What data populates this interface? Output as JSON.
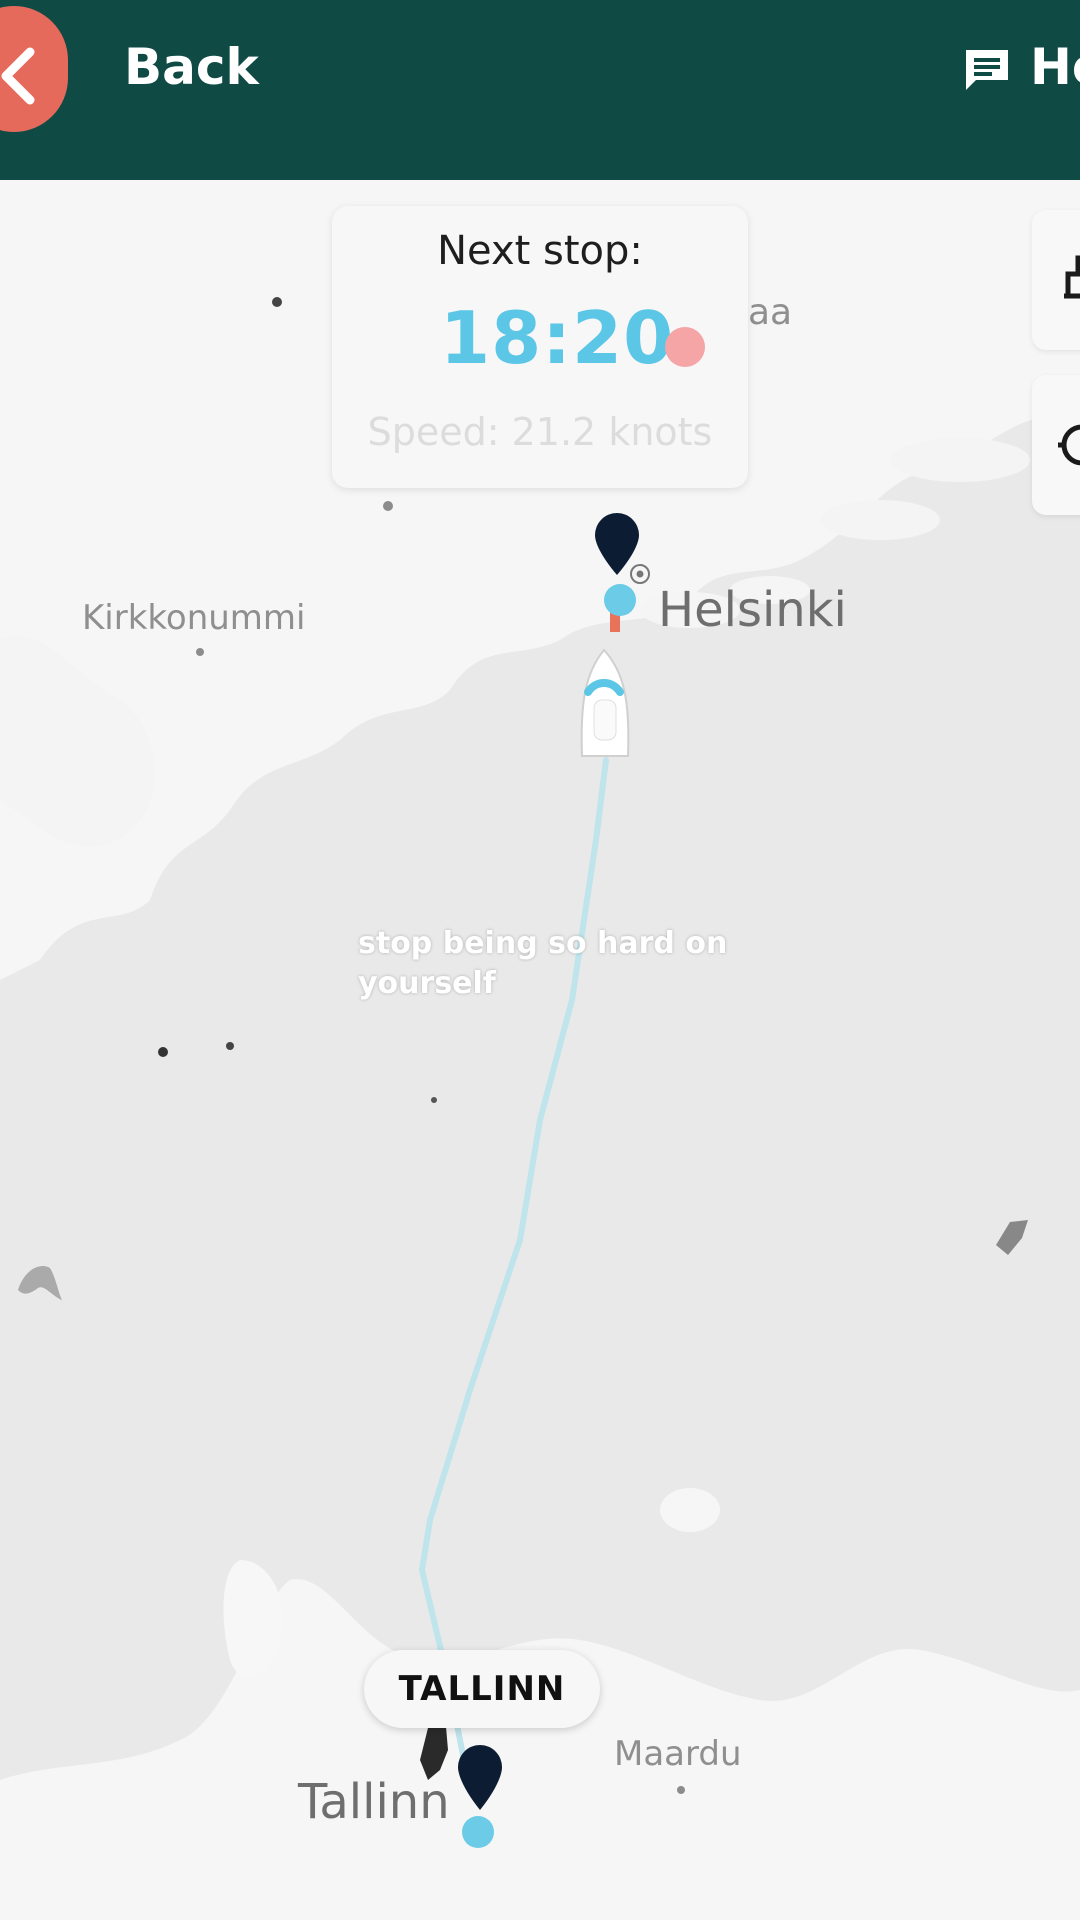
{
  "header": {
    "back_label": "Back",
    "help_label": "He"
  },
  "next_stop": {
    "title": "Next stop:",
    "time": "18:20",
    "speed": "Speed: 21.2 knots"
  },
  "map": {
    "places": {
      "kirkkonummi": "Kirkkonummi",
      "helsinki": "Helsinki",
      "maardu": "Maardu",
      "tallinn": "Tallinn",
      "partial_top": "aa"
    },
    "destination_chip": "TALLINN",
    "caption": "stop being so hard on yourself"
  },
  "colors": {
    "header_bg": "#0f4a44",
    "back_button": "#e56a5b",
    "accent_time": "#5cc6e6",
    "status_dot": "#f5a5a5",
    "route": "#bfe4ec",
    "pin": "#0c1d33"
  },
  "icons": {
    "back": "chevron-left-icon",
    "help": "chat-bubble-icon",
    "ship": "ship-icon",
    "pin": "map-pin-icon"
  }
}
